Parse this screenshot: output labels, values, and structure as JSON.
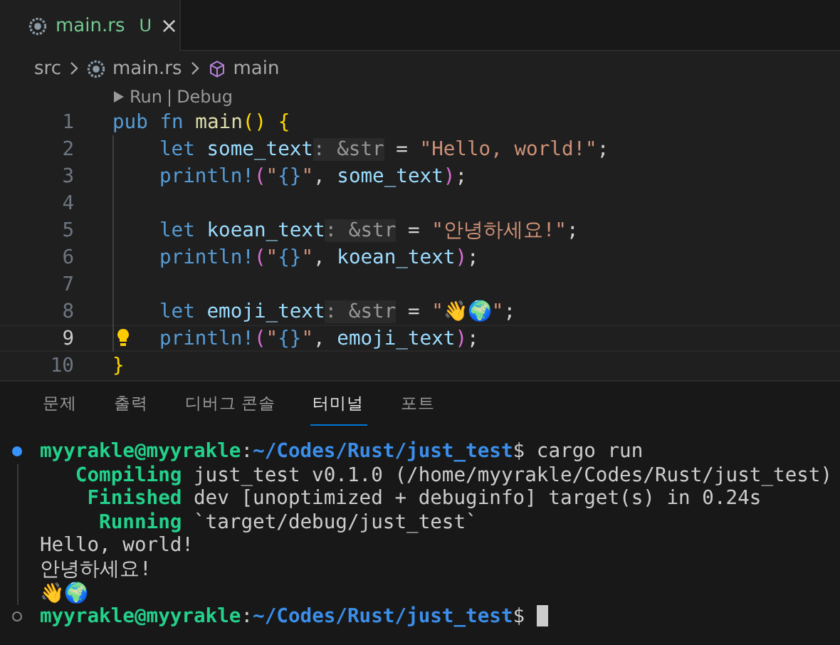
{
  "tabs": [
    {
      "label": "main.rs",
      "status": "U",
      "close": "×",
      "selected": true
    }
  ],
  "breadcrumb": [
    "src",
    "main.rs",
    "main"
  ],
  "codelens": {
    "run": "Run",
    "separator": "|",
    "debug": "Debug"
  },
  "code_lines": [
    {
      "number": "1",
      "active": false,
      "indented": false,
      "bulb": false,
      "tokens": [
        {
          "kind": "keyword",
          "text": "pub"
        },
        {
          "kind": "keyword",
          "text": " fn"
        },
        {
          "kind": "function",
          "text": " main"
        },
        {
          "kind": "bracket1",
          "text": "()"
        },
        {
          "kind": "bracket1",
          "text": " {"
        }
      ]
    },
    {
      "number": "2",
      "active": false,
      "indented": true,
      "bulb": false,
      "tokens": [
        {
          "kind": "keyword",
          "text": "let"
        },
        {
          "kind": "variable",
          "text": " some_text"
        },
        {
          "kind": "hint",
          "text": ": &str"
        },
        {
          "kind": "plain",
          "text": " = "
        },
        {
          "kind": "string",
          "text": "\"Hello, world!\""
        },
        {
          "kind": "plain",
          "text": ";"
        }
      ]
    },
    {
      "number": "3",
      "active": false,
      "indented": true,
      "bulb": false,
      "tokens": [
        {
          "kind": "macro",
          "text": "println!"
        },
        {
          "kind": "bracket2",
          "text": "("
        },
        {
          "kind": "string",
          "text": "\""
        },
        {
          "kind": "macro",
          "text": "{}"
        },
        {
          "kind": "string",
          "text": "\""
        },
        {
          "kind": "plain",
          "text": ", "
        },
        {
          "kind": "variable",
          "text": "some_text"
        },
        {
          "kind": "bracket2",
          "text": ")"
        },
        {
          "kind": "plain",
          "text": ";"
        }
      ]
    },
    {
      "number": "4",
      "active": false,
      "indented": true,
      "bulb": false
    },
    {
      "number": "5",
      "active": false,
      "indented": true,
      "bulb": false,
      "tokens": [
        {
          "kind": "keyword",
          "text": "let"
        },
        {
          "kind": "variable",
          "text": " koean_text"
        },
        {
          "kind": "hint",
          "text": ": &str"
        },
        {
          "kind": "plain",
          "text": " = "
        },
        {
          "kind": "string",
          "text": "\"안녕하세요!\""
        },
        {
          "kind": "plain",
          "text": ";"
        }
      ]
    },
    {
      "number": "6",
      "active": false,
      "indented": true,
      "bulb": false,
      "tokens": [
        {
          "kind": "macro",
          "text": "println!"
        },
        {
          "kind": "bracket2",
          "text": "("
        },
        {
          "kind": "string",
          "text": "\""
        },
        {
          "kind": "macro",
          "text": "{}"
        },
        {
          "kind": "string",
          "text": "\""
        },
        {
          "kind": "plain",
          "text": ", "
        },
        {
          "kind": "variable",
          "text": "koean_text"
        },
        {
          "kind": "bracket2",
          "text": ")"
        },
        {
          "kind": "plain",
          "text": ";"
        }
      ]
    },
    {
      "number": "7",
      "active": false,
      "indented": true,
      "bulb": false
    },
    {
      "number": "8",
      "active": false,
      "indented": true,
      "bulb": false,
      "tokens": [
        {
          "kind": "keyword",
          "text": "let"
        },
        {
          "kind": "variable",
          "text": " emoji_text"
        },
        {
          "kind": "hint",
          "text": ": &str"
        },
        {
          "kind": "plain",
          "text": " = "
        },
        {
          "kind": "string",
          "text": "\"👋🌍\""
        },
        {
          "kind": "plain",
          "text": ";"
        }
      ]
    },
    {
      "number": "9",
      "active": true,
      "indented": true,
      "bulb": true,
      "tokens": [
        {
          "kind": "macro",
          "text": "println!"
        },
        {
          "kind": "bracket2",
          "text": "("
        },
        {
          "kind": "string",
          "text": "\""
        },
        {
          "kind": "macro",
          "text": "{}"
        },
        {
          "kind": "string",
          "text": "\""
        },
        {
          "kind": "plain",
          "text": ", "
        },
        {
          "kind": "variable",
          "text": "emoji_text"
        },
        {
          "kind": "bracket2",
          "text": ")"
        },
        {
          "kind": "plain",
          "text": ";"
        }
      ]
    },
    {
      "number": "10",
      "active": false,
      "indented": false,
      "bulb": false,
      "tokens": [
        {
          "kind": "bracket1",
          "text": "}"
        }
      ]
    }
  ],
  "panel_tabs": [
    {
      "label": "문제",
      "selected": false
    },
    {
      "label": "출력",
      "selected": false
    },
    {
      "label": "디버그 콘솔",
      "selected": false
    },
    {
      "label": "터미널",
      "selected": true
    },
    {
      "label": "포트",
      "selected": false
    }
  ],
  "terminal_lines": [
    {
      "kind": "command",
      "segments": [
        {
          "kind": "user",
          "text": "myyrakle@myyrakle"
        },
        {
          "kind": "plain",
          "text": ":"
        },
        {
          "kind": "path",
          "text": "~/Codes/Rust/just_test"
        },
        {
          "kind": "plain",
          "text": "$ cargo run"
        }
      ]
    },
    {
      "kind": "output",
      "segments": [
        {
          "kind": "status",
          "text": "   Compiling"
        },
        {
          "kind": "plain",
          "text": " just_test v0.1.0 (/home/myyrakle/Codes/Rust/just_test)"
        }
      ]
    },
    {
      "kind": "output",
      "segments": [
        {
          "kind": "status",
          "text": "    Finished"
        },
        {
          "kind": "plain",
          "text": " dev [unoptimized + debuginfo] target(s) in 0.24s"
        }
      ]
    },
    {
      "kind": "output",
      "segments": [
        {
          "kind": "status",
          "text": "     Running"
        },
        {
          "kind": "plain",
          "text": " `target/debug/just_test`"
        }
      ]
    },
    {
      "kind": "output",
      "segments": [
        {
          "kind": "plain",
          "text": "Hello, world!"
        }
      ]
    },
    {
      "kind": "output",
      "segments": [
        {
          "kind": "plain",
          "text": "안녕하세요!"
        }
      ]
    },
    {
      "kind": "output",
      "segments": [
        {
          "kind": "plain",
          "text": "👋🌍"
        }
      ]
    },
    {
      "kind": "prompt",
      "cursor": true,
      "segments": [
        {
          "kind": "user",
          "text": "myyrakle@myyrakle"
        },
        {
          "kind": "plain",
          "text": ":"
        },
        {
          "kind": "path",
          "text": "~/Codes/Rust/just_test"
        },
        {
          "kind": "plain",
          "text": "$ "
        }
      ]
    }
  ]
}
